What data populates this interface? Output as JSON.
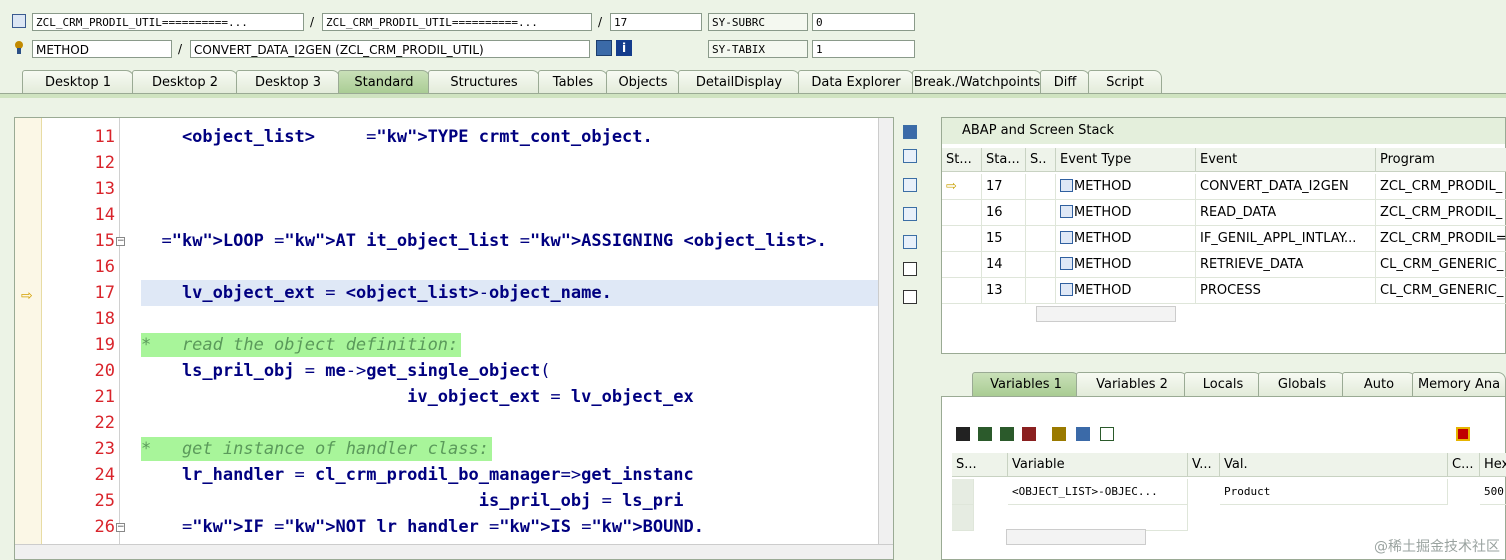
{
  "header": {
    "row1": {
      "program_field": "ZCL_CRM_PRODIL_UTIL==========...",
      "include_field": "ZCL_CRM_PRODIL_UTIL==========...",
      "line_field": "17",
      "sysvar1_label": "SY-SUBRC",
      "sysvar1_value": "0"
    },
    "row2": {
      "type_field": "METHOD",
      "event_field": "CONVERT_DATA_I2GEN (ZCL_CRM_PRODIL_UTIL)",
      "sysvar2_label": "SY-TABIX",
      "sysvar2_value": "1"
    },
    "separator": "/"
  },
  "tabs": [
    "Desktop 1",
    "Desktop 2",
    "Desktop 3",
    "Standard",
    "Structures",
    "Tables",
    "Objects",
    "DetailDisplay",
    "Data Explorer",
    "Break./Watchpoints",
    "Diff",
    "Script"
  ],
  "active_tab": "Standard",
  "code_lines": [
    {
      "n": "11",
      "text": "    <object_list>     TYPE crmt_cont_object."
    },
    {
      "n": "12",
      "text": ""
    },
    {
      "n": "13",
      "text": ""
    },
    {
      "n": "14",
      "text": ""
    },
    {
      "n": "15",
      "text": "  LOOP AT it_object_list ASSIGNING <object_list>."
    },
    {
      "n": "16",
      "text": ""
    },
    {
      "n": "17",
      "text": "    lv_object_ext = <object_list>-object_name."
    },
    {
      "n": "18",
      "text": ""
    },
    {
      "n": "19",
      "text": "*   read the object definition:"
    },
    {
      "n": "20",
      "text": "    ls_pril_obj = me->get_single_object("
    },
    {
      "n": "21",
      "text": "                          iv_object_ext = lv_object_ex"
    },
    {
      "n": "22",
      "text": ""
    },
    {
      "n": "23",
      "text": "*   get instance of handler class:"
    },
    {
      "n": "24",
      "text": "    lr_handler = cl_crm_prodil_bo_manager=>get_instanc"
    },
    {
      "n": "25",
      "text": "                                 is_pril_obj = ls_pri"
    },
    {
      "n": "26",
      "text": "    IF NOT lr handler IS BOUND."
    }
  ],
  "stack": {
    "title": "ABAP and Screen Stack",
    "columns": [
      "St...",
      "Sta...",
      "S..",
      "Event Type",
      "Event",
      "Program"
    ],
    "rows": [
      {
        "level": "17",
        "type": "METHOD",
        "event": "CONVERT_DATA_I2GEN",
        "program": "ZCL_CRM_PRODIL_"
      },
      {
        "level": "16",
        "type": "METHOD",
        "event": "READ_DATA",
        "program": "ZCL_CRM_PRODIL_"
      },
      {
        "level": "15",
        "type": "METHOD",
        "event": "IF_GENIL_APPL_INTLAY...",
        "program": "ZCL_CRM_PRODIL="
      },
      {
        "level": "14",
        "type": "METHOD",
        "event": "RETRIEVE_DATA",
        "program": "CL_CRM_GENERIC_"
      },
      {
        "level": "13",
        "type": "METHOD",
        "event": "PROCESS",
        "program": "CL_CRM_GENERIC_"
      }
    ]
  },
  "var_tabs": [
    "Variables 1",
    "Variables 2",
    "Locals",
    "Globals",
    "Auto",
    "Memory Ana"
  ],
  "variables": {
    "columns": [
      "S...",
      "Variable",
      "V...",
      "Val.",
      "C...",
      "Hex"
    ],
    "rows": [
      {
        "variable": "<OBJECT_LIST>-OBJEC...",
        "value": "Product",
        "hex": "500"
      }
    ]
  },
  "watermark": "@稀土掘金技术社区"
}
